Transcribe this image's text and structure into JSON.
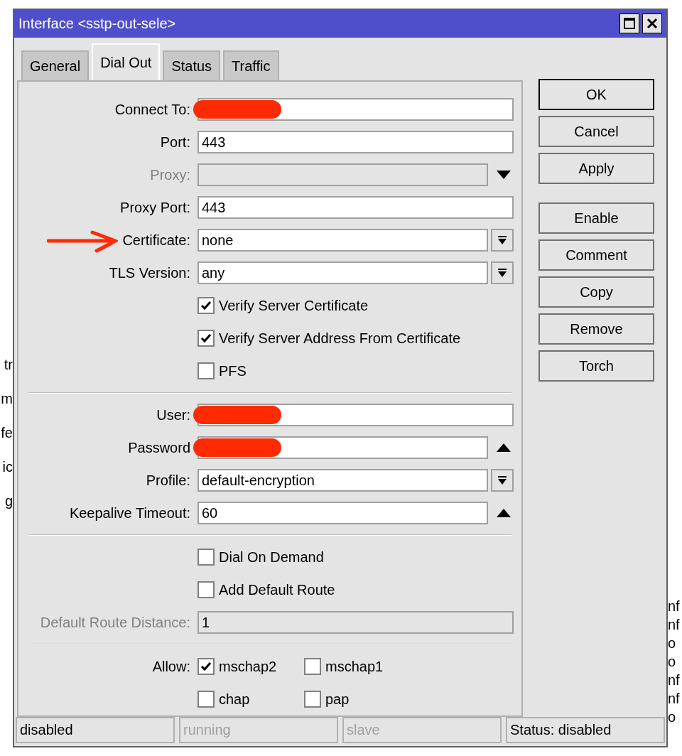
{
  "window": {
    "title": "Interface <sstp-out-sele>"
  },
  "tabs": [
    {
      "label": "General",
      "selected": false
    },
    {
      "label": "Dial Out",
      "selected": true
    },
    {
      "label": "Status",
      "selected": false
    },
    {
      "label": "Traffic",
      "selected": false
    }
  ],
  "form": [
    {
      "kind": "text",
      "label": "Connect To:",
      "redacted": true
    },
    {
      "kind": "text",
      "label": "Port:",
      "value": "443"
    },
    {
      "kind": "dropdown",
      "label": "Proxy:",
      "disabled": true
    },
    {
      "kind": "text",
      "label": "Proxy Port:",
      "value": "443"
    },
    {
      "kind": "select",
      "label": "Certificate:",
      "value": "none",
      "arrow_mark": true
    },
    {
      "kind": "select",
      "label": "TLS Version:",
      "value": "any"
    },
    {
      "kind": "checkbox",
      "label": "Verify Server Certificate",
      "checked": true
    },
    {
      "kind": "checkbox",
      "label": "Verify Server Address From Certificate",
      "checked": true
    },
    {
      "kind": "checkbox",
      "label": "PFS",
      "checked": false
    },
    {
      "kind": "separator"
    },
    {
      "kind": "text",
      "label": "User:",
      "redacted": true
    },
    {
      "kind": "collapse",
      "label": "Password",
      "redacted": true
    },
    {
      "kind": "select",
      "label": "Profile:",
      "value": "default-encryption"
    },
    {
      "kind": "collapse",
      "label": "Keepalive Timeout:",
      "value": "60"
    },
    {
      "kind": "separator"
    },
    {
      "kind": "checkbox",
      "label": "Dial On Demand",
      "checked": false
    },
    {
      "kind": "checkbox",
      "label": "Add Default Route",
      "checked": false
    },
    {
      "kind": "text",
      "label": "Default Route Distance:",
      "value": "1",
      "disabled": true
    },
    {
      "kind": "separator"
    }
  ],
  "allow": {
    "label": "Allow:",
    "options": [
      {
        "label": "mschap2",
        "checked": true
      },
      {
        "label": "mschap1",
        "checked": false
      },
      {
        "label": "chap",
        "checked": false
      },
      {
        "label": "pap",
        "checked": false
      }
    ]
  },
  "buttons": [
    {
      "label": "OK",
      "default": true
    },
    {
      "label": "Cancel",
      "default": false
    },
    {
      "label": "Apply",
      "default": false
    }
  ],
  "actions": [
    {
      "label": "Enable"
    },
    {
      "label": "Comment"
    },
    {
      "label": "Copy"
    },
    {
      "label": "Remove"
    },
    {
      "label": "Torch"
    }
  ],
  "status_bar": [
    {
      "text": "disabled",
      "active": true
    },
    {
      "text": "running",
      "active": false
    },
    {
      "text": "slave",
      "active": false
    },
    {
      "text": "Status: disabled",
      "active": true
    }
  ],
  "background": {
    "left": [
      "tr",
      "m",
      "fe",
      "ic",
      "g"
    ],
    "right": [
      "nf",
      "nf",
      "o",
      "o",
      "nf",
      "nf",
      "o"
    ]
  }
}
